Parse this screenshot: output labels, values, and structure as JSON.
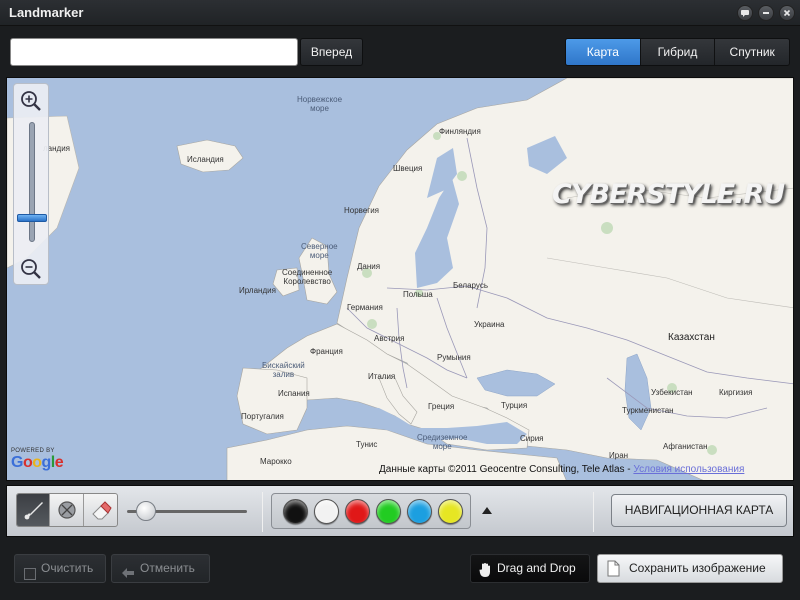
{
  "window": {
    "title": "Landmarker"
  },
  "titlebar": {
    "buttons": [
      "chat-icon",
      "minimize-icon",
      "close-icon"
    ]
  },
  "search": {
    "value": "",
    "go_label": "Вперед"
  },
  "map_types": [
    {
      "label": "Карта",
      "active": true
    },
    {
      "label": "Гибрид",
      "active": false
    },
    {
      "label": "Спутник",
      "active": false
    }
  ],
  "map": {
    "labels": {
      "norwegian_sea": "Норвежское\nморе",
      "greenland": "ландия",
      "iceland": "Исландия",
      "finland": "Финляндия",
      "sweden": "Швеция",
      "norway": "Норвегия",
      "north_sea": "Северное\nморе",
      "denmark": "Дания",
      "uk": "Соединенное\nКоролевство",
      "ireland": "Ирландия",
      "belarus": "Беларусь",
      "poland": "Польша",
      "germany": "Германия",
      "ukraine": "Украина",
      "france": "Франция",
      "austria": "Австрия",
      "romania": "Румыния",
      "biscay": "Бискайский\nзалив",
      "italy": "Италия",
      "spain": "Испания",
      "portugal": "Португалия",
      "greece": "Греция",
      "turkey": "Турция",
      "kazakhstan": "Казахстан",
      "uzbekistan": "Узбекистан",
      "kyrgyzstan": "Киргизия",
      "turkmenistan": "Туркменистан",
      "tunisia": "Тунис",
      "morocco": "Марокко",
      "mediterranean": "Средиземное\nморе",
      "syria": "Сирия",
      "iran": "Иран",
      "afghanistan": "Афганистан"
    },
    "watermark": "CYBERSTYLE.RU",
    "attribution": "Данные карты ©2011 Geocentre Consulting, Tele Atlas - ",
    "terms_link": "Условия использования",
    "google_powered": "POWERED BY",
    "google_word": "Google"
  },
  "toolbar": {
    "tools": [
      "brush-icon",
      "shape-icon",
      "eraser-icon"
    ],
    "brush_size": 0.08,
    "colors": [
      "#111111",
      "#f2f2f2",
      "#e01818",
      "#22cc22",
      "#1c9fe0",
      "#e6e623"
    ],
    "nav_map_label": "НАВИГАЦИОННАЯ КАРТА"
  },
  "bottom": {
    "clear_label": "Очистить",
    "undo_label": "Отменить",
    "dnd_label": "Drag and Drop",
    "save_label": "Сохранить изображение"
  }
}
